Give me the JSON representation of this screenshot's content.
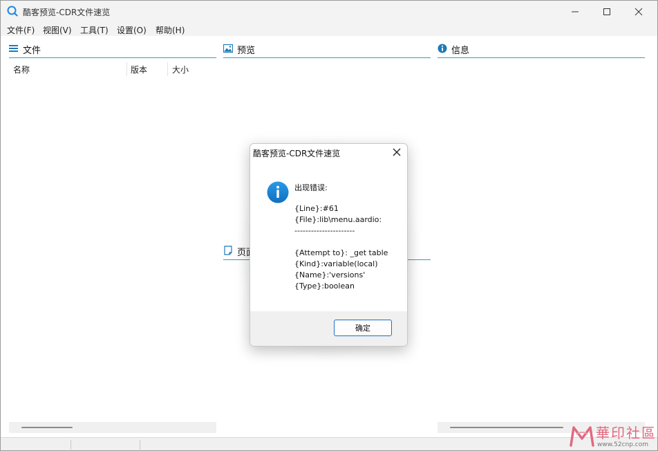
{
  "window": {
    "title": "酷客预览-CDR文件速览",
    "icons": {
      "app": "search-app-icon",
      "minimize": "minimize-icon",
      "maximize": "maximize-icon",
      "close": "close-icon"
    }
  },
  "menu": [
    "文件(F)",
    "视图(V)",
    "工具(T)",
    "设置(O)",
    "帮助(H)"
  ],
  "panels": {
    "files": {
      "title": "文件",
      "icon": "list-icon",
      "columns": [
        "名称",
        "版本",
        "大小"
      ]
    },
    "preview": {
      "title": "预览",
      "icon": "image-icon"
    },
    "info": {
      "title": "信息",
      "icon": "info-icon"
    },
    "pages": {
      "title": "页面",
      "icon": "page-icon"
    }
  },
  "dialog": {
    "title": "酷客预览-CDR文件速览",
    "icon": "info-icon",
    "lines": [
      "出现错误:",
      "",
      "{Line}:#61",
      "{File}:lib\\menu.aardio:",
      "----------------------",
      "",
      "{Attempt to}: _get table",
      "{Kind}:variable(local)",
      "{Name}:'versions'",
      "{Type}:boolean"
    ],
    "ok_label": "确定"
  },
  "watermark": {
    "text": "華印社區",
    "url": "www.52cnp.com"
  },
  "colors": {
    "accent": "#3b9bb7",
    "info_blue": "#1e88e5",
    "button_border": "#1e6fc8"
  }
}
